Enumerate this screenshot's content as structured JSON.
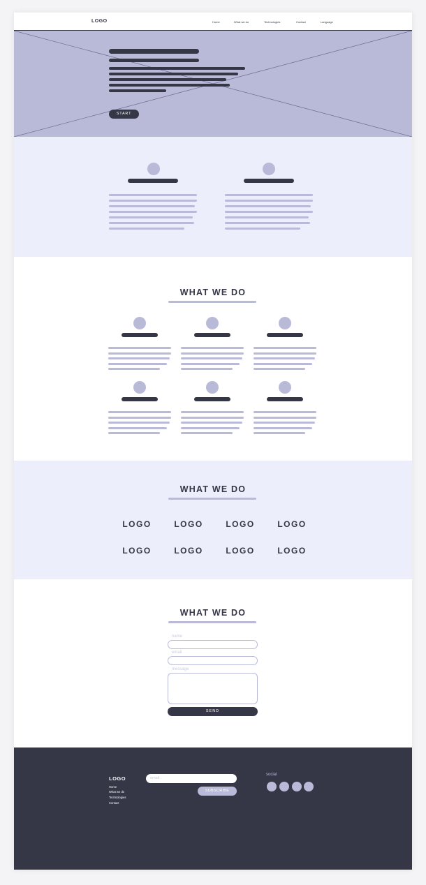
{
  "nav": {
    "logo": "LOGO",
    "links": [
      "Home",
      "What we do",
      "Technologies",
      "Contact",
      "Language"
    ]
  },
  "hero": {
    "button_label": "START"
  },
  "what_we_do": {
    "title": "WHAT WE DO"
  },
  "partners": {
    "title": "WHAT WE DO",
    "logos": [
      "LOGO",
      "LOGO",
      "LOGO",
      "LOGO",
      "LOGO",
      "LOGO",
      "LOGO",
      "LOGO"
    ]
  },
  "contact": {
    "title": "WHAT WE DO",
    "name_label": "name",
    "email_label": "email",
    "message_label": "message",
    "send_label": "SEND"
  },
  "footer": {
    "logo": "LOGO",
    "links": [
      "Home",
      "What we do",
      "Technologies",
      "Contact"
    ],
    "email_placeholder": "email",
    "subscribe_label": "SUBSCRIBE",
    "social_label": "social"
  },
  "colors": {
    "dark": "#353646",
    "accent": "#b9bad7",
    "light_bg": "#eceefb"
  },
  "icons": [
    "avatar-placeholder-icon",
    "social-icon",
    "image-placeholder-cross"
  ]
}
